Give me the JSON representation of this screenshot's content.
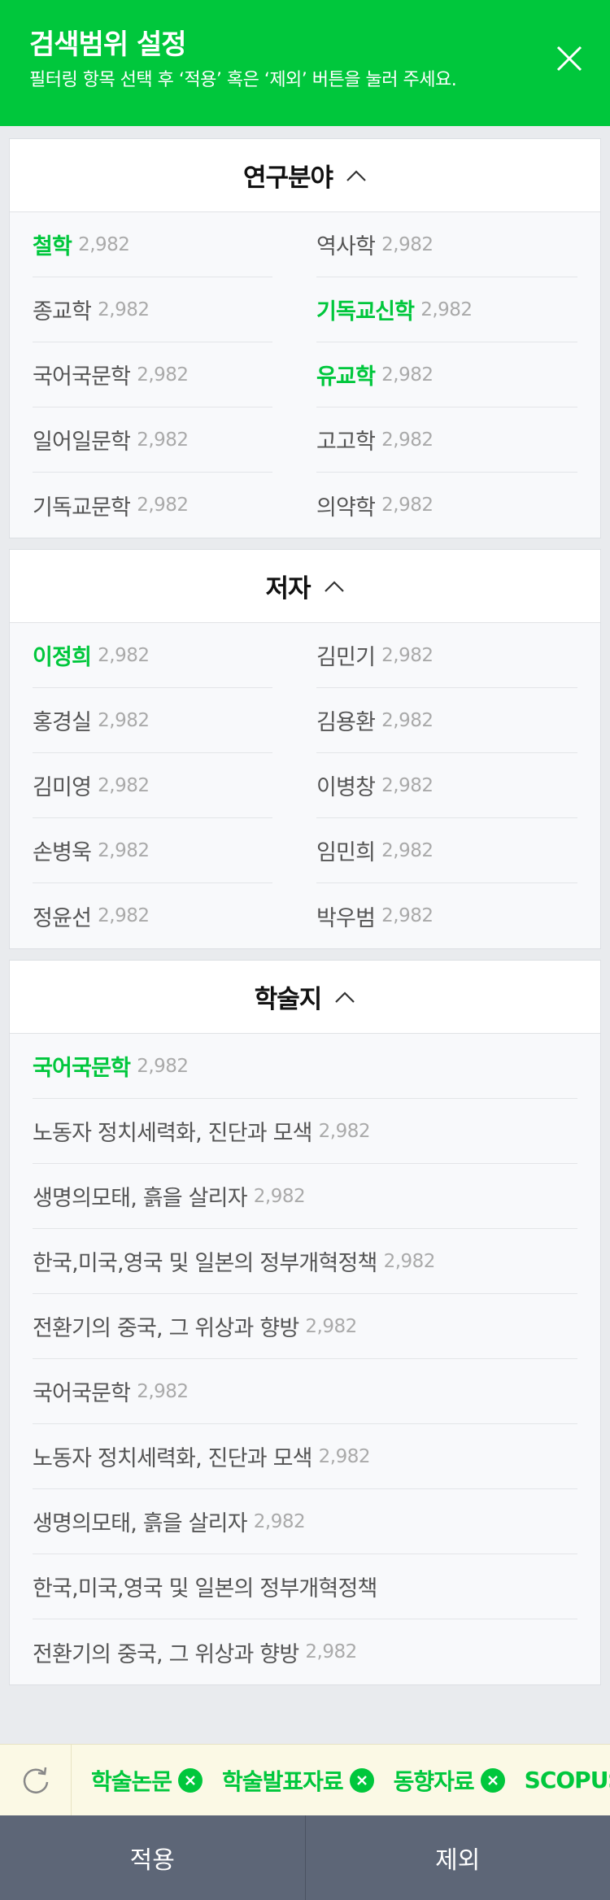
{
  "header": {
    "title": "검색범위 설정",
    "subtitle": "필터링 항목 선택 후 ‘적용’ 혹은 ‘제외’ 버튼을 눌러 주세요."
  },
  "sections": [
    {
      "title": "연구분야",
      "layout": "grid",
      "items": [
        {
          "name": "철학",
          "count": "2,982",
          "selected": true
        },
        {
          "name": "역사학",
          "count": "2,982",
          "selected": false
        },
        {
          "name": "종교학",
          "count": "2,982",
          "selected": false
        },
        {
          "name": "기독교신학",
          "count": "2,982",
          "selected": true
        },
        {
          "name": "국어국문학",
          "count": "2,982",
          "selected": false
        },
        {
          "name": "유교학",
          "count": "2,982",
          "selected": true
        },
        {
          "name": "일어일문학",
          "count": "2,982",
          "selected": false
        },
        {
          "name": "고고학",
          "count": "2,982",
          "selected": false
        },
        {
          "name": "기독교문학",
          "count": "2,982",
          "selected": false
        },
        {
          "name": "의약학",
          "count": "2,982",
          "selected": false
        }
      ]
    },
    {
      "title": "저자",
      "layout": "grid",
      "items": [
        {
          "name": "이정희",
          "count": "2,982",
          "selected": true
        },
        {
          "name": "김민기",
          "count": "2,982",
          "selected": false
        },
        {
          "name": "홍경실",
          "count": "2,982",
          "selected": false
        },
        {
          "name": "김용환",
          "count": "2,982",
          "selected": false
        },
        {
          "name": "김미영",
          "count": "2,982",
          "selected": false
        },
        {
          "name": "이병창",
          "count": "2,982",
          "selected": false
        },
        {
          "name": "손병욱",
          "count": "2,982",
          "selected": false
        },
        {
          "name": "임민희",
          "count": "2,982",
          "selected": false
        },
        {
          "name": "정윤선",
          "count": "2,982",
          "selected": false
        },
        {
          "name": "박우범",
          "count": "2,982",
          "selected": false
        }
      ]
    },
    {
      "title": "학술지",
      "layout": "list",
      "items": [
        {
          "name": "국어국문학",
          "count": "2,982",
          "selected": true
        },
        {
          "name": "노동자 정치세력화, 진단과 모색",
          "count": "2,982",
          "selected": false
        },
        {
          "name": "생명의모태, 흙을 살리자",
          "count": "2,982",
          "selected": false
        },
        {
          "name": "한국,미국,영국 및 일본의 정부개혁정책",
          "count": "2,982",
          "selected": false
        },
        {
          "name": "전환기의 중국, 그 위상과 향방",
          "count": "2,982",
          "selected": false
        },
        {
          "name": "국어국문학",
          "count": "2,982",
          "selected": false
        },
        {
          "name": "노동자 정치세력화, 진단과 모색",
          "count": "2,982",
          "selected": false
        },
        {
          "name": "생명의모태, 흙을 살리자",
          "count": "2,982",
          "selected": false
        },
        {
          "name": "한국,미국,영국 및 일본의 정부개혁정책",
          "count": "",
          "selected": false
        },
        {
          "name": "전환기의 중국, 그 위상과 향방",
          "count": "2,982",
          "selected": false
        }
      ]
    }
  ],
  "chips": [
    {
      "label": "학술논문"
    },
    {
      "label": "학술발표자료"
    },
    {
      "label": "동향자료"
    },
    {
      "label": "SCOPUS"
    }
  ],
  "footer": {
    "apply_label": "적용",
    "exclude_label": "제외"
  },
  "colors": {
    "accent": "#00c73c",
    "footer_bg": "#5d6677",
    "chip_bar_bg": "#fbf9e5"
  },
  "icons": {
    "close": "close-icon",
    "chevron": "chevron-up-icon",
    "refresh": "refresh-icon",
    "chip_remove": "remove-circle-icon"
  }
}
